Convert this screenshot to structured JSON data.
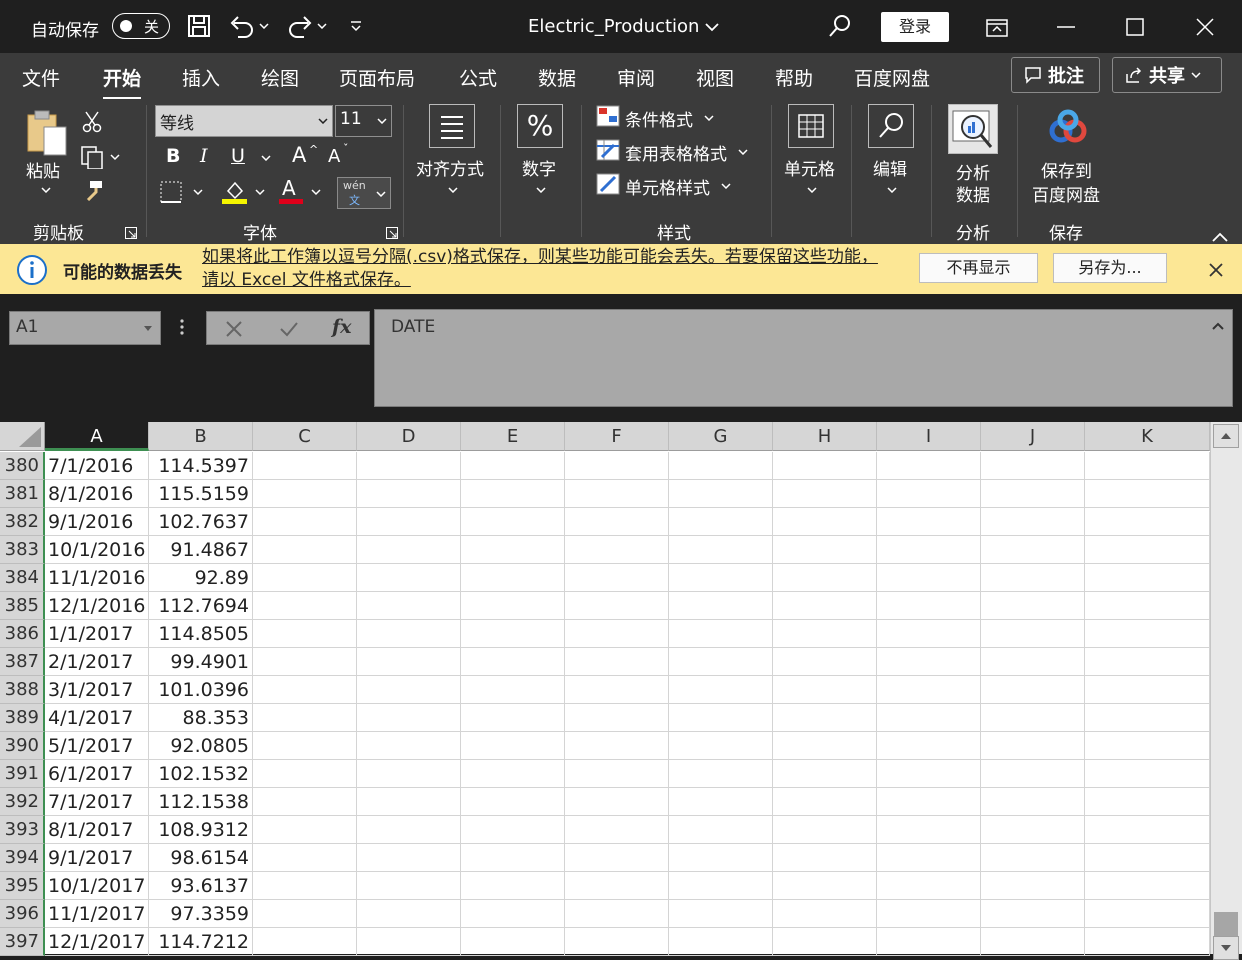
{
  "titlebar": {
    "autosave_label": "自动保存",
    "autosave_state": "关",
    "doc_title": "Electric_Production",
    "login_label": "登录"
  },
  "tabs": [
    "文件",
    "开始",
    "插入",
    "绘图",
    "页面布局",
    "公式",
    "数据",
    "审阅",
    "视图",
    "帮助",
    "百度网盘"
  ],
  "active_tab": "开始",
  "pills": {
    "comment": "批注",
    "share": "共享"
  },
  "ribbon": {
    "paste": "粘贴",
    "clipboard_group": "剪贴板",
    "font_name": "等线",
    "font_size": "11",
    "bold": "B",
    "italic": "I",
    "underline": "U",
    "grow": "A",
    "shrink": "A",
    "font_color_letter": "A",
    "phonetic_top": "wén",
    "phonetic_bottom": "文",
    "font_group": "字体",
    "align": "对齐方式",
    "number_symbol": "%",
    "number": "数字",
    "cond_format": "条件格式",
    "table_format": "套用表格格式",
    "cell_style": "单元格样式",
    "styles_group": "样式",
    "cells": "单元格",
    "edit": "编辑",
    "analyze_1": "分析",
    "analyze_2": "数据",
    "analyze_group": "分析",
    "save_to_1": "保存到",
    "save_to_2": "百度网盘",
    "save_group": "保存"
  },
  "infobar": {
    "title": "可能的数据丢失",
    "message": "如果将此工作簿以逗号分隔(.csv)格式保存，则某些功能可能会丢失。若要保留这些功能，请以 Excel 文件格式保存。",
    "dont_show": "不再显示",
    "save_as": "另存为..."
  },
  "formula_bar": {
    "name_box": "A1",
    "formula": "DATE",
    "fx": "fx"
  },
  "columns": [
    "A",
    "B",
    "C",
    "D",
    "E",
    "F",
    "G",
    "H",
    "I",
    "J",
    "K"
  ],
  "rows": [
    {
      "num": "380",
      "date": "7/1/2016",
      "value": "114.5397"
    },
    {
      "num": "381",
      "date": "8/1/2016",
      "value": "115.5159"
    },
    {
      "num": "382",
      "date": "9/1/2016",
      "value": "102.7637"
    },
    {
      "num": "383",
      "date": "10/1/2016",
      "value": "91.4867"
    },
    {
      "num": "384",
      "date": "11/1/2016",
      "value": "92.89"
    },
    {
      "num": "385",
      "date": "12/1/2016",
      "value": "112.7694"
    },
    {
      "num": "386",
      "date": "1/1/2017",
      "value": "114.8505"
    },
    {
      "num": "387",
      "date": "2/1/2017",
      "value": "99.4901"
    },
    {
      "num": "388",
      "date": "3/1/2017",
      "value": "101.0396"
    },
    {
      "num": "389",
      "date": "4/1/2017",
      "value": "88.353"
    },
    {
      "num": "390",
      "date": "5/1/2017",
      "value": "92.0805"
    },
    {
      "num": "391",
      "date": "6/1/2017",
      "value": "102.1532"
    },
    {
      "num": "392",
      "date": "7/1/2017",
      "value": "112.1538"
    },
    {
      "num": "393",
      "date": "8/1/2017",
      "value": "108.9312"
    },
    {
      "num": "394",
      "date": "9/1/2017",
      "value": "98.6154"
    },
    {
      "num": "395",
      "date": "10/1/2017",
      "value": "93.6137"
    },
    {
      "num": "396",
      "date": "11/1/2017",
      "value": "97.3359"
    },
    {
      "num": "397",
      "date": "12/1/2017",
      "value": "114.7212"
    }
  ],
  "colors": {
    "accent_green": "#3e8f52",
    "infobar": "#fce795",
    "title_bg": "#1f1f1f",
    "ribbon_bg": "#3b3b3b"
  }
}
